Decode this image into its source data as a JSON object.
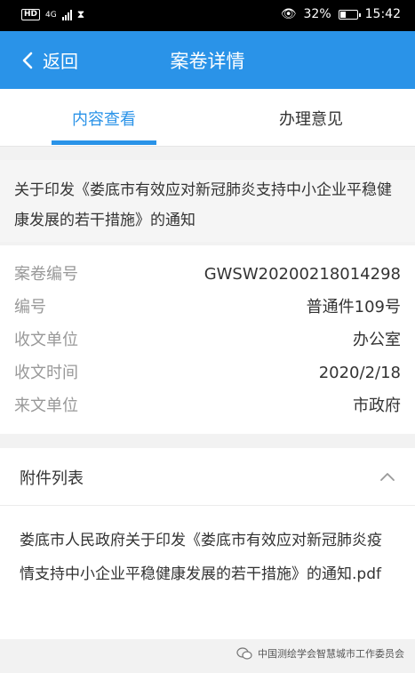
{
  "status_bar": {
    "hd_label": "HD",
    "network": "4G",
    "battery_percent": "32%",
    "battery_level": 0.32,
    "time": "15:42"
  },
  "app_bar": {
    "back_label": "返回",
    "title": "案卷详情"
  },
  "tabs": [
    {
      "label": "内容查看",
      "active": true
    },
    {
      "label": "办理意见",
      "active": false
    }
  ],
  "document": {
    "title": "关于印发《娄底市有效应对新冠肺炎支持中小企业平稳健康发展的若干措施》的通知"
  },
  "details": [
    {
      "key": "案卷编号",
      "value": "GWSW20200218014298"
    },
    {
      "key": "编号",
      "value": "普通件109号"
    },
    {
      "key": "收文单位",
      "value": "办公室"
    },
    {
      "key": "收文时间",
      "value": "2020/2/18"
    },
    {
      "key": "来文单位",
      "value": "市政府"
    }
  ],
  "attachments": {
    "heading": "附件列表",
    "items": [
      "娄底市人民政府关于印发《娄底市有效应对新冠肺炎疫情支持中小企业平稳健康发展的若干措施》的通知.pdf"
    ]
  },
  "watermark": {
    "text": "中国测绘学会智慧城市工作委员会"
  }
}
